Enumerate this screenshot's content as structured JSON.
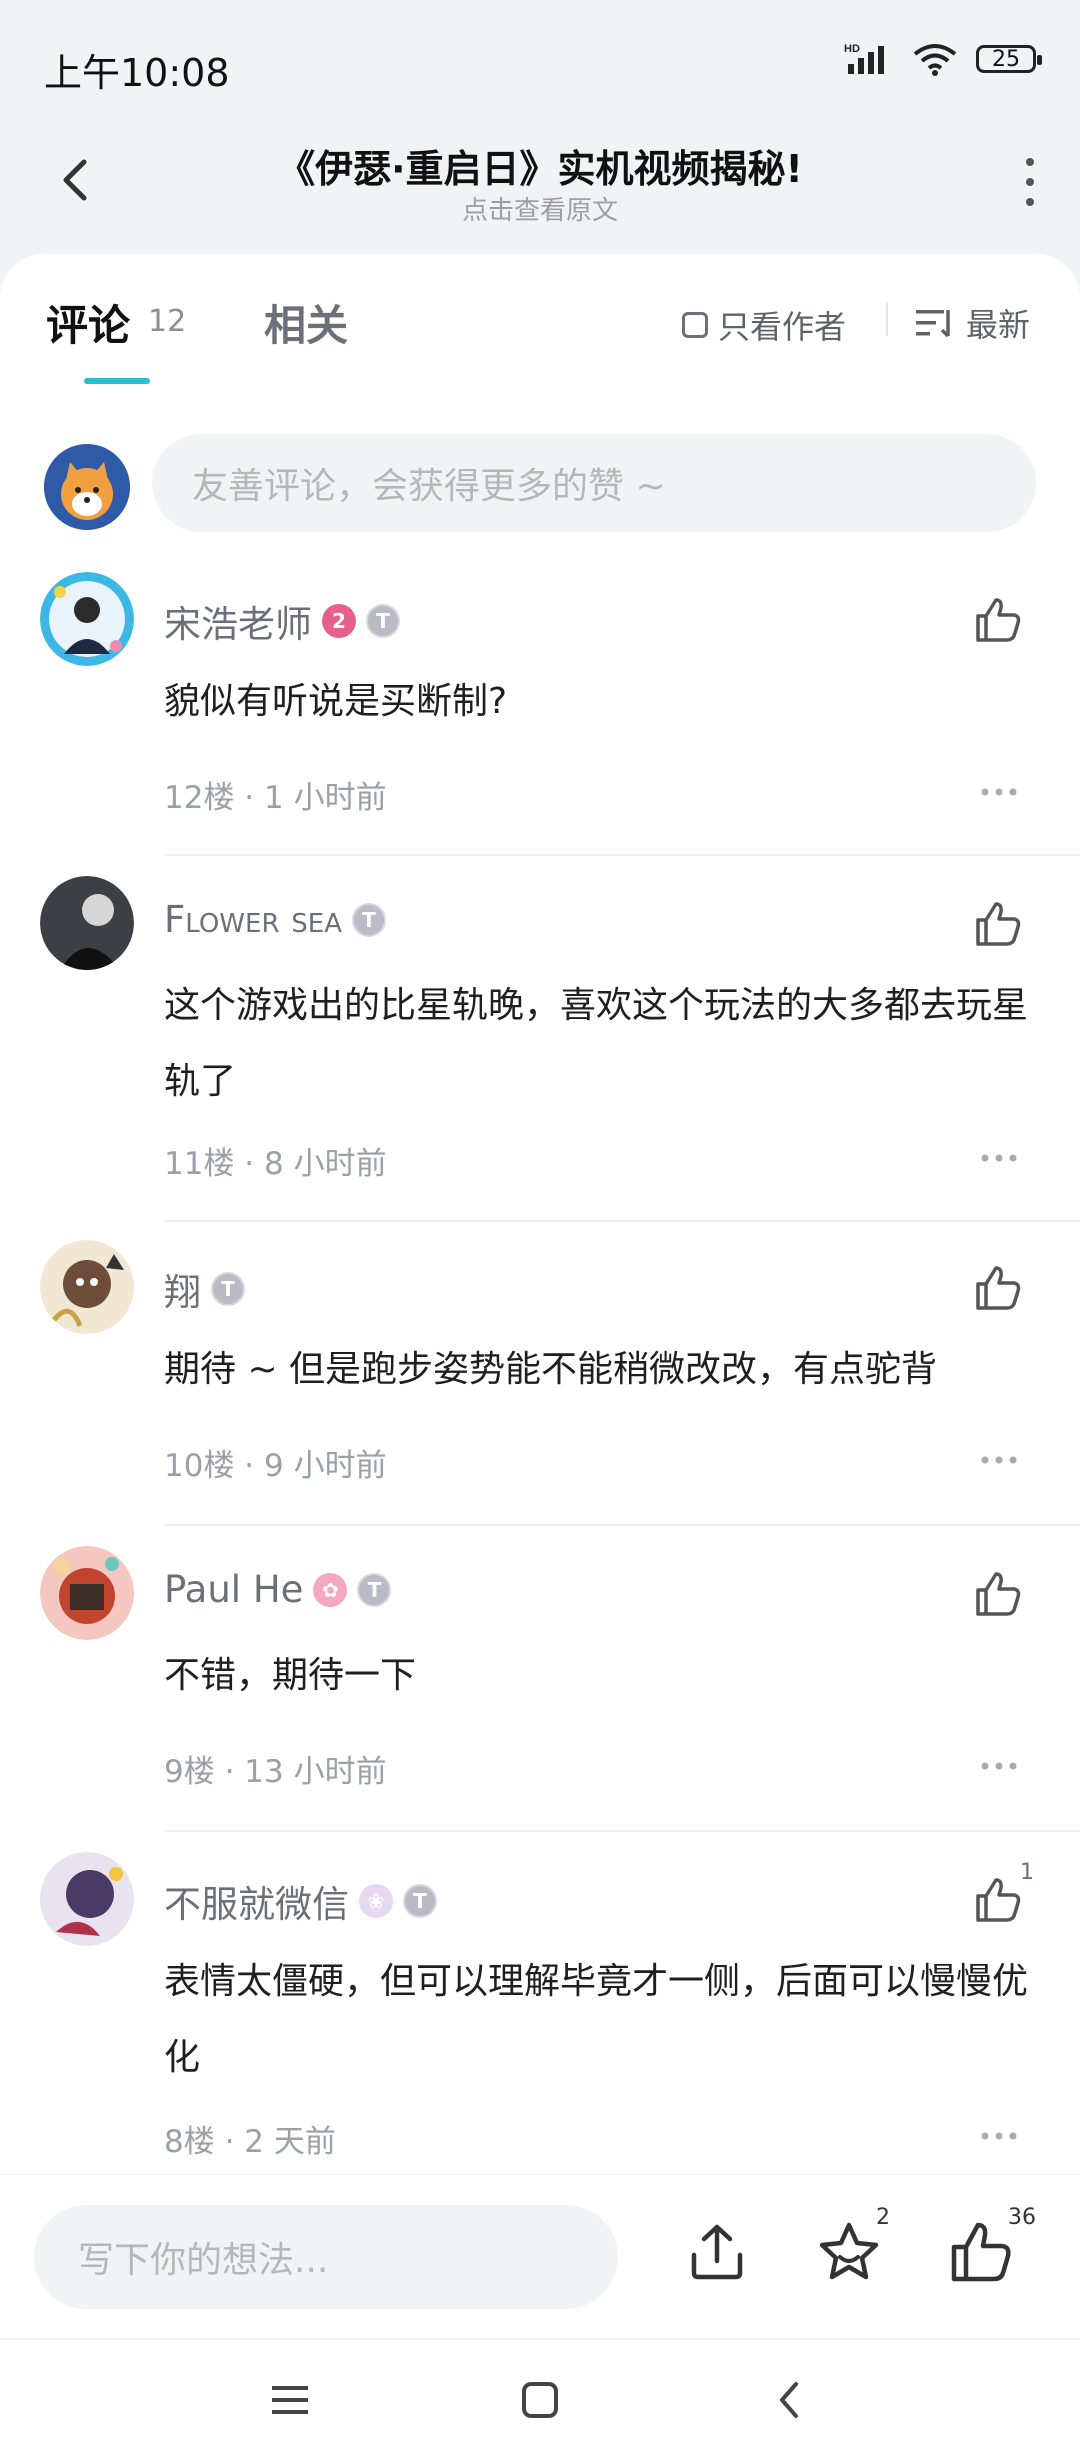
{
  "status": {
    "time": "上午10:08",
    "battery": "25",
    "network": "HD"
  },
  "header": {
    "title": "《伊瑟·重启日》实机视频揭秘!",
    "subtitle": "点击查看原文"
  },
  "tabs": {
    "comments_label": "评论",
    "comments_count": "12",
    "related_label": "相关",
    "author_only": "只看作者",
    "sort_label": "最新"
  },
  "composer": {
    "placeholder": "友善评论，会获得更多的赞 ~"
  },
  "comments": [
    {
      "name": "宋浩老师",
      "badge1": "2",
      "text": "貌似有听说是买断制?",
      "meta": "12楼 · 1 小时前",
      "likes": ""
    },
    {
      "name": "Flower sea",
      "text": "这个游戏出的比星轨晚，喜欢这个玩法的大多都去玩星轨了",
      "meta": "11楼 · 8 小时前",
      "likes": ""
    },
    {
      "name": "翔",
      "text": "期待 ~ 但是跑步姿势能不能稍微改改，有点驼背",
      "meta": "10楼 · 9 小时前",
      "likes": ""
    },
    {
      "name": "Paul He",
      "text": "不错，期待一下",
      "meta": "9楼 · 13 小时前",
      "likes": ""
    },
    {
      "name": "不服就微信",
      "text": "表情太僵硬，但可以理解毕竟才一侧，后面可以慢慢优化",
      "meta": "8楼 · 2 天前",
      "likes": "1"
    }
  ],
  "bottom": {
    "placeholder": "写下你的想法...",
    "favorites_count": "2",
    "likes_count": "36"
  },
  "icons": {
    "back": "chevron-left-icon",
    "more": "more-vertical-icon",
    "sort": "sort-icon",
    "like": "thumbs-up-icon",
    "share": "share-icon",
    "star": "star-icon",
    "nav_menu": "menu-icon",
    "nav_home": "square-icon",
    "nav_back": "back-icon"
  },
  "colors": {
    "accent": "#25c3c9",
    "text": "#1f1f1f",
    "muted": "#9aa0a6"
  }
}
